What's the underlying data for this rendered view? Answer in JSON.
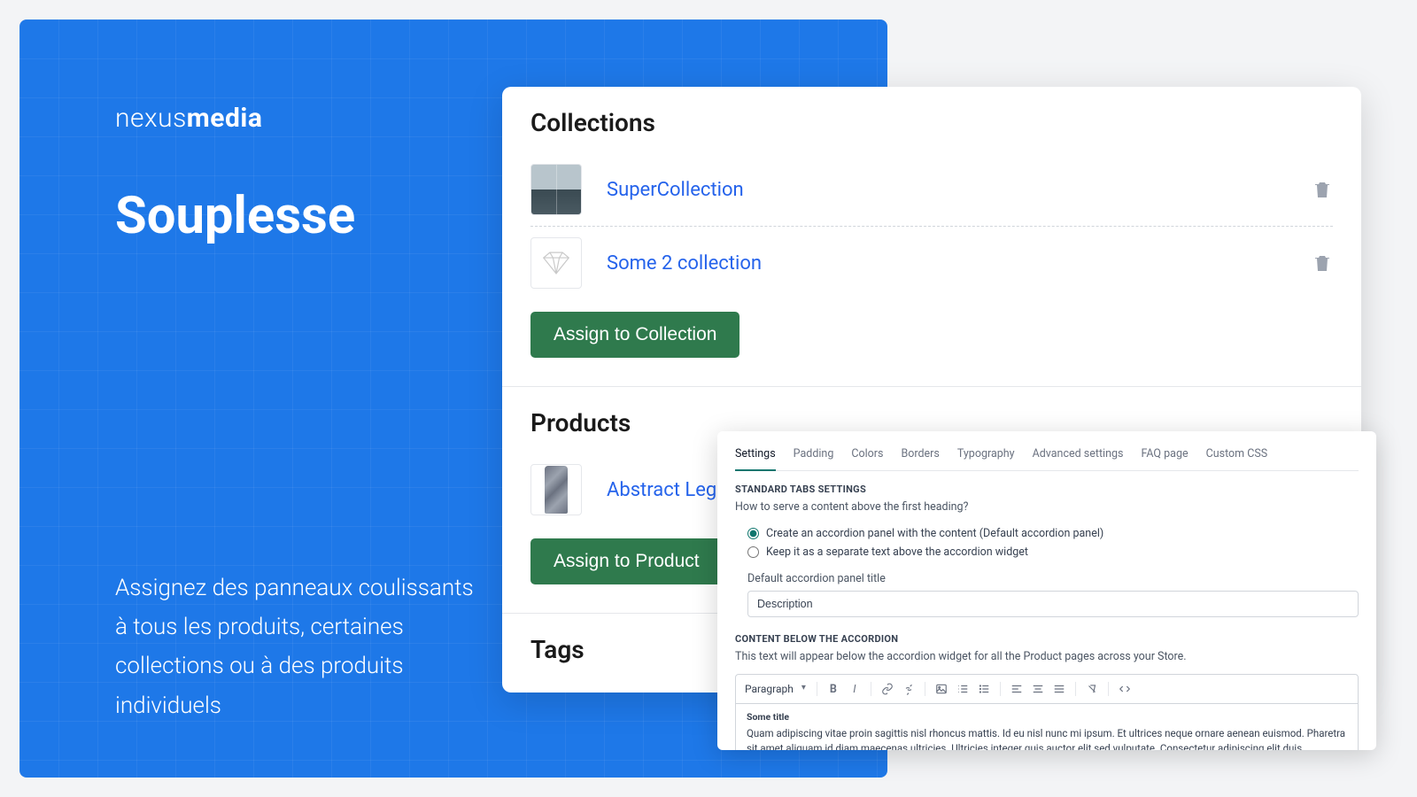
{
  "brand": {
    "prefix": "nexus",
    "suffix": "media"
  },
  "headline": "Souplesse",
  "blurb": "Assignez des panneaux coulissants à tous les produits, certaines collections ou à des produits individuels",
  "collections": {
    "title": "Collections",
    "items": [
      {
        "label": "SuperCollection"
      },
      {
        "label": "Some 2 collection"
      }
    ],
    "button": "Assign to Collection"
  },
  "products": {
    "title": "Products",
    "items": [
      {
        "label": "Abstract Leg"
      }
    ],
    "button": "Assign to Product"
  },
  "tags": {
    "title": "Tags"
  },
  "settings": {
    "tabs": [
      "Settings",
      "Padding",
      "Colors",
      "Borders",
      "Typography",
      "Advanced settings",
      "FAQ page",
      "Custom CSS"
    ],
    "activeTab": 0,
    "sect1_title": "STANDARD TABS SETTINGS",
    "sect1_sub": "How to serve a content above the first heading?",
    "radio1": "Create an accordion panel with the content (Default accordion panel)",
    "radio2": "Keep it as a separate text above the accordion widget",
    "field_label": "Default accordion panel title",
    "field_value": "Description",
    "sect2_title": "CONTENT BELOW THE ACCORDION",
    "sect2_sub": "This text will appear below the accordion widget for all the Product pages across your Store.",
    "toolbar_paragraph": "Paragraph",
    "editor_heading": "Some title",
    "editor_body": "Quam adipiscing vitae proin sagittis nisl rhoncus mattis. Id eu nisl nunc mi ipsum. Et ultrices neque ornare aenean euismod. Pharetra sit amet aliquam id diam maecenas ultricies. Ultricies integer quis auctor elit sed vulputate. Consectetur adipiscing elit duis"
  }
}
